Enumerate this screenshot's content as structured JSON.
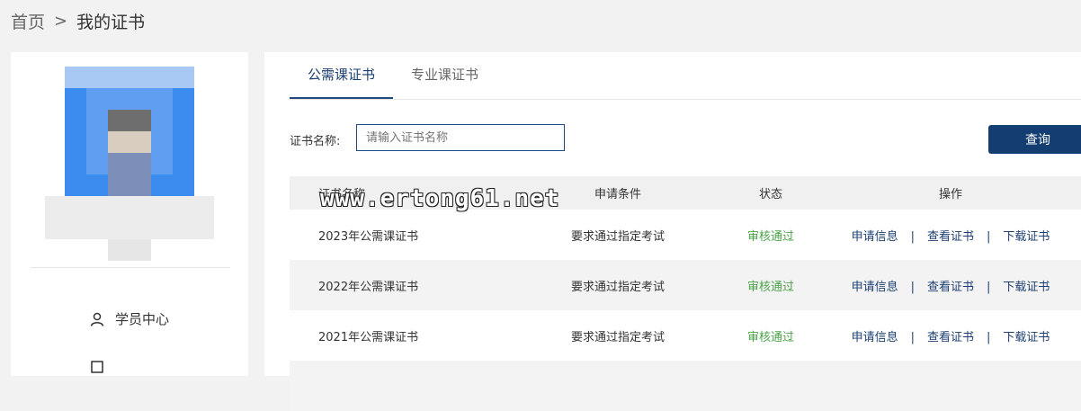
{
  "breadcrumb": {
    "home": "首页",
    "separator": ">",
    "current": "我的证书"
  },
  "sidebar": {
    "menu": [
      {
        "icon": "user-icon",
        "label": "学员中心"
      }
    ]
  },
  "tabs": [
    {
      "label": "公需课证书",
      "active": true
    },
    {
      "label": "专业课证书",
      "active": false
    }
  ],
  "filter": {
    "label": "证书名称:",
    "placeholder": "请输入证书名称",
    "button": "查询"
  },
  "table": {
    "headers": [
      "证书名称",
      "申请条件",
      "状态",
      "操作"
    ],
    "rows": [
      {
        "name": "2023年公需课证书",
        "condition": "要求通过指定考试",
        "status": "审核通过",
        "ops": [
          "申请信息",
          "查看证书",
          "下载证书"
        ]
      },
      {
        "name": "2022年公需课证书",
        "condition": "要求通过指定考试",
        "status": "审核通过",
        "ops": [
          "申请信息",
          "查看证书",
          "下载证书"
        ]
      },
      {
        "name": "2021年公需课证书",
        "condition": "要求通过指定考试",
        "status": "审核通过",
        "ops": [
          "申请信息",
          "查看证书",
          "下载证书"
        ]
      }
    ],
    "op_separator": "|"
  },
  "watermark": "www.ertong61.net",
  "colors": {
    "accent": "#143e72",
    "status_ok": "#4aa34a",
    "background": "#f2f2f2"
  }
}
